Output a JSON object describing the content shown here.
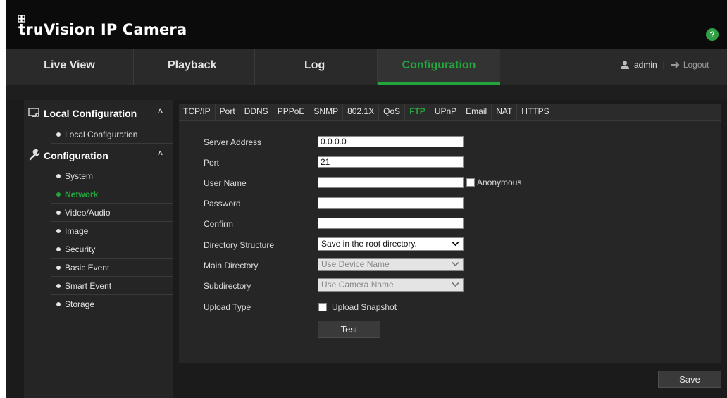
{
  "app": {
    "brand": "truVision IP Camera"
  },
  "header": {
    "help_glyph": "?"
  },
  "nav": {
    "tabs": [
      {
        "label": "Live View"
      },
      {
        "label": "Playback"
      },
      {
        "label": "Log"
      },
      {
        "label": "Configuration",
        "active": true
      }
    ],
    "user": "admin",
    "separator": "|",
    "logout": "Logout"
  },
  "sidebar": {
    "sections": [
      {
        "label": "Local Configuration",
        "icon": "monitor-gear-icon",
        "caret": "^",
        "items": [
          {
            "label": "Local Configuration"
          }
        ]
      },
      {
        "label": "Configuration",
        "icon": "wrench-icon",
        "caret": "^",
        "items": [
          {
            "label": "System"
          },
          {
            "label": "Network",
            "active": true
          },
          {
            "label": "Video/Audio"
          },
          {
            "label": "Image"
          },
          {
            "label": "Security"
          },
          {
            "label": "Basic Event"
          },
          {
            "label": "Smart Event"
          },
          {
            "label": "Storage"
          }
        ]
      }
    ]
  },
  "tabs": [
    "TCP/IP",
    "Port",
    "DDNS",
    "PPPoE",
    "SNMP",
    "802.1X",
    "QoS",
    "FTP",
    "UPnP",
    "Email",
    "NAT",
    "HTTPS"
  ],
  "active_tab": "FTP",
  "form": {
    "server_address": {
      "label": "Server Address",
      "value": "0.0.0.0"
    },
    "port": {
      "label": "Port",
      "value": "21"
    },
    "user_name": {
      "label": "User Name",
      "value": ""
    },
    "anonymous": {
      "label": "Anonymous",
      "checked": false
    },
    "password": {
      "label": "Password",
      "value": ""
    },
    "confirm": {
      "label": "Confirm",
      "value": ""
    },
    "directory_structure": {
      "label": "Directory Structure",
      "value": "Save in the root directory."
    },
    "main_directory": {
      "label": "Main Directory",
      "value": "Use Device Name"
    },
    "subdirectory": {
      "label": "Subdirectory",
      "value": "Use Camera Name"
    },
    "upload_type": {
      "label": "Upload Type"
    },
    "upload_snapshot": {
      "label": "Upload Snapshot",
      "checked": false
    },
    "test_label": "Test"
  },
  "save_label": "Save",
  "colors": {
    "accent": "#21a53c",
    "background": "#1b1b1b",
    "panel": "#262626"
  }
}
